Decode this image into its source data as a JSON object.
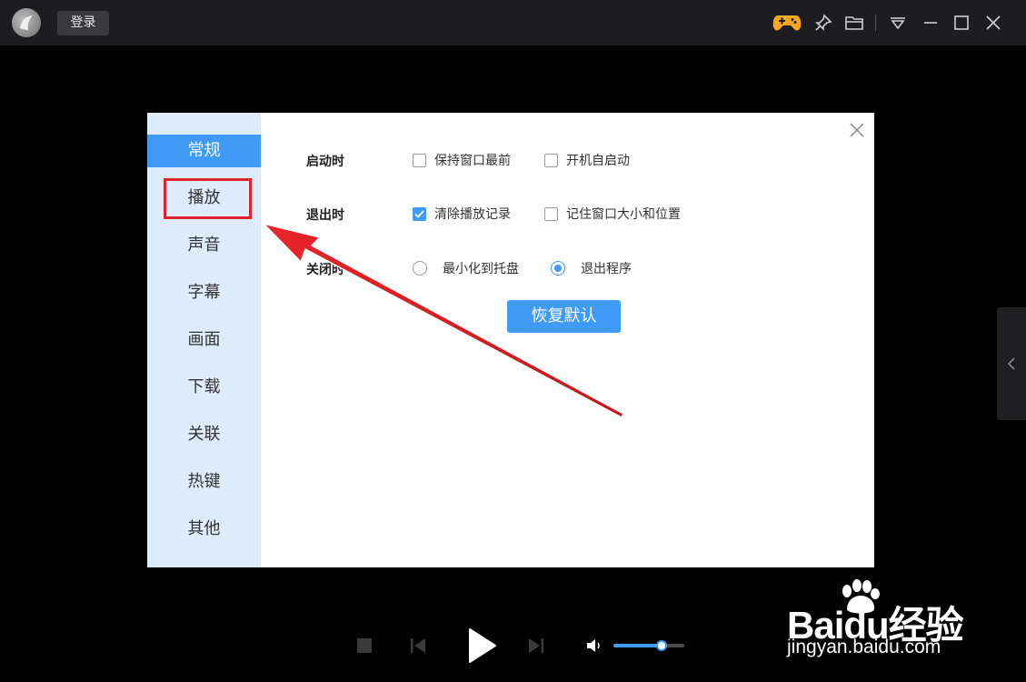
{
  "titlebar": {
    "login_label": "登录",
    "icons": [
      "app-logo-icon",
      "gamepad-icon",
      "pin-icon",
      "folder-icon",
      "menu-dropdown-icon",
      "minimize-icon",
      "maximize-icon",
      "close-icon"
    ]
  },
  "dialog": {
    "sidebar": {
      "items": [
        {
          "label": "常规",
          "active": true
        },
        {
          "label": "播放",
          "active": false
        },
        {
          "label": "声音",
          "active": false
        },
        {
          "label": "字幕",
          "active": false
        },
        {
          "label": "画面",
          "active": false
        },
        {
          "label": "下载",
          "active": false
        },
        {
          "label": "关联",
          "active": false
        },
        {
          "label": "热键",
          "active": false
        },
        {
          "label": "其他",
          "active": false
        }
      ]
    },
    "rows": [
      {
        "label": "启动时",
        "options": [
          {
            "type": "checkbox",
            "label": "保持窗口最前",
            "checked": false
          },
          {
            "type": "checkbox",
            "label": "开机自启动",
            "checked": false
          }
        ]
      },
      {
        "label": "退出时",
        "options": [
          {
            "type": "checkbox",
            "label": "清除播放记录",
            "checked": true
          },
          {
            "type": "checkbox",
            "label": "记住窗口大小和位置",
            "checked": false
          }
        ]
      },
      {
        "label": "关闭时",
        "options": [
          {
            "type": "radio",
            "label": "最小化到托盘",
            "checked": false
          },
          {
            "type": "radio",
            "label": "退出程序",
            "checked": true
          }
        ]
      }
    ],
    "restore_label": "恢复默认"
  },
  "player": {
    "volume": 0.68
  },
  "watermark": {
    "main": "Baidu经验",
    "sub": "jingyan.baidu.com"
  },
  "colors": {
    "accent": "#3f9bf7",
    "sidebar_bg": "#deebfb",
    "annotation_red": "#e0242b",
    "gamepad": "#f5a623"
  }
}
